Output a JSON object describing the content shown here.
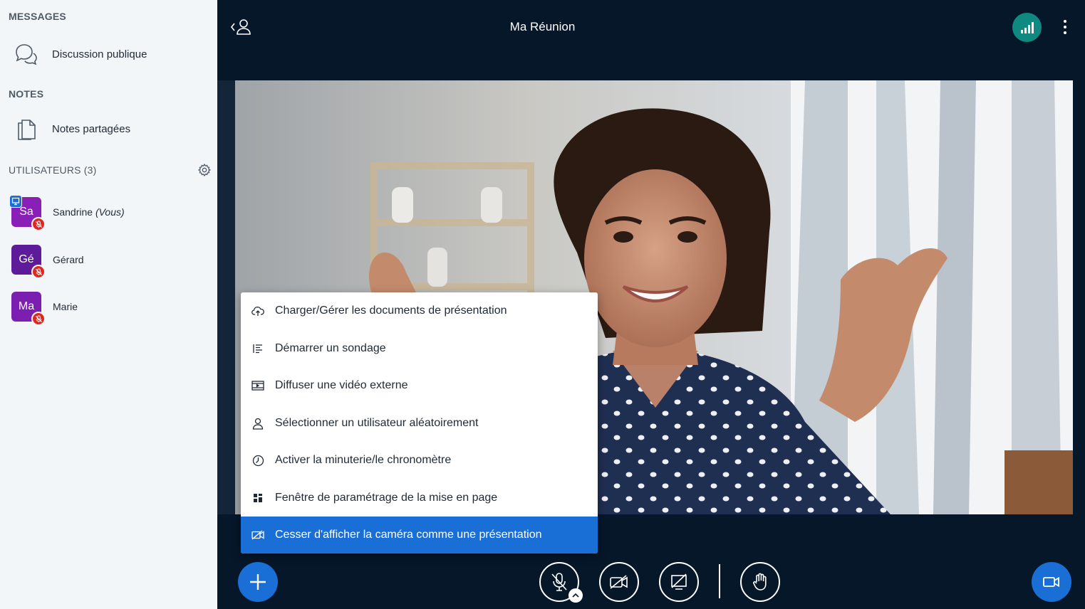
{
  "sidebar": {
    "messages_title": "MESSAGES",
    "public_chat_label": "Discussion publique",
    "notes_title": "NOTES",
    "shared_notes_label": "Notes partagées",
    "users_title": "UTILISATEURS (3)",
    "users": [
      {
        "initials": "Sa",
        "name": "Sandrine",
        "suffix": "(Vous)",
        "color": "#8a1fb8",
        "presenter": true,
        "muted": true
      },
      {
        "initials": "Gé",
        "name": "Gérard",
        "suffix": "",
        "color": "#5e1b99",
        "presenter": false,
        "muted": true
      },
      {
        "initials": "Ma",
        "name": "Marie",
        "suffix": "",
        "color": "#7a1fb0",
        "presenter": false,
        "muted": true
      }
    ]
  },
  "header": {
    "title": "Ma Réunion"
  },
  "menu": {
    "items": [
      {
        "label": "Charger/Gérer les documents de présentation",
        "icon": "upload-cloud-icon"
      },
      {
        "label": "Démarrer un sondage",
        "icon": "poll-list-icon"
      },
      {
        "label": "Diffuser une vidéo externe",
        "icon": "external-video-icon"
      },
      {
        "label": "Sélectionner un utilisateur aléatoirement",
        "icon": "user-icon"
      },
      {
        "label": "Activer la minuterie/le chronomètre",
        "icon": "timer-icon"
      },
      {
        "label": "Fenêtre de paramétrage de la mise en page",
        "icon": "layout-grid-icon"
      },
      {
        "label": "Cesser d'afficher la caméra comme une présentation",
        "icon": "camera-off-presentation-icon",
        "active": true
      }
    ]
  },
  "colors": {
    "accent": "#1a6fd6",
    "background": "#06172a",
    "connection_ok": "#0f8a80",
    "muted_badge": "#df2721"
  }
}
